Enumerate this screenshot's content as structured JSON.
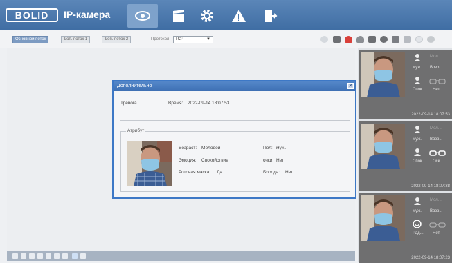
{
  "header": {
    "logo": "BOLID",
    "title": "IP-камера",
    "nav": [
      {
        "icon": "eye-icon"
      },
      {
        "icon": "clapperboard-icon"
      },
      {
        "icon": "gear-icon"
      },
      {
        "icon": "warning-icon"
      },
      {
        "icon": "logout-icon"
      }
    ]
  },
  "toolbar": {
    "streams": [
      "Основной поток",
      "Доп. поток 1",
      "Доп. поток 2"
    ],
    "protocol_label": "Протокол",
    "protocol_value": "TCP"
  },
  "dialog": {
    "title": "Дополнительно",
    "close": "✕",
    "alarm_label": "Тревога",
    "time_label": "Время:",
    "time_value": "2022-09-14 18:07:53",
    "group_label": "Атрибут",
    "attributes": [
      {
        "label": "Возраст:",
        "value": "Молодой"
      },
      {
        "label": "Эмоция:",
        "value": "Спокойствие"
      },
      {
        "label": "Ротовая маска:",
        "value": "Да"
      },
      {
        "label": "Пол:",
        "value": "муж."
      },
      {
        "label": "очки:",
        "value": "Нет"
      },
      {
        "label": "Борода:",
        "value": "Нет"
      }
    ]
  },
  "sidebar": {
    "cards": [
      {
        "a": "Мол...",
        "b": "муж.",
        "c": "Возр...",
        "d": "Спок...",
        "e": "Нет",
        "time": "2022-09-14 18:07:53"
      },
      {
        "a": "Мол...",
        "b": "муж.",
        "c": "Возр...",
        "d": "Спок...",
        "e": "Оск...",
        "time": "2022-09-14 18:07:38"
      },
      {
        "a": "Мол...",
        "b": "муж.",
        "c": "Возр...",
        "d": "Рад...",
        "e": "Нет",
        "time": "2022-09-14 18:07:23"
      }
    ]
  },
  "colors": {
    "accent": "#3d78c6",
    "header": "#4a78ad",
    "card": "#6f6f70"
  }
}
